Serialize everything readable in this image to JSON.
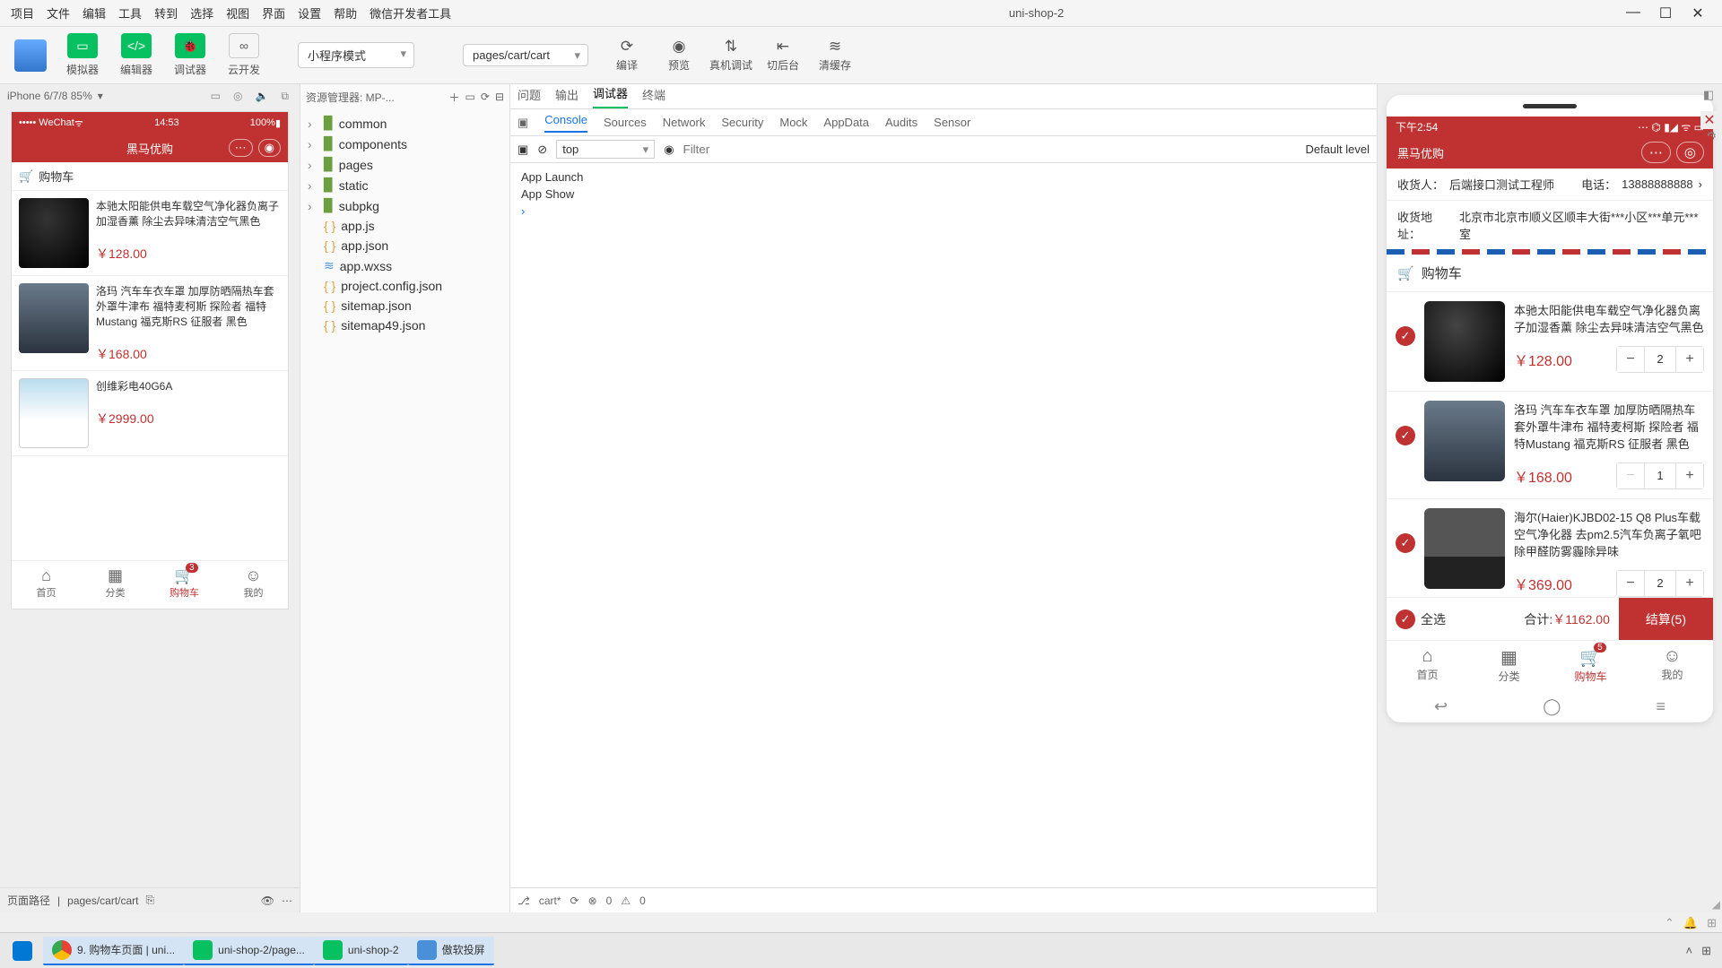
{
  "menu": [
    "项目",
    "文件",
    "编辑",
    "工具",
    "转到",
    "选择",
    "视图",
    "界面",
    "设置",
    "帮助",
    "微信开发者工具"
  ],
  "app_title": "uni-shop-2",
  "win_buttons": [
    "—",
    "☐",
    "✕"
  ],
  "toolbar": {
    "simulator": "模拟器",
    "editor": "编辑器",
    "debugger": "调试器",
    "cloud": "云开发",
    "mode": "小程序模式",
    "page": "pages/cart/cart",
    "compile": "编译",
    "preview": "预览",
    "realdebug": "真机调试",
    "bg": "切后台",
    "cache": "清缓存"
  },
  "sim": {
    "device": "iPhone 6/7/8 85%",
    "carrier": "••••• WeChat",
    "time": "14:53",
    "battery": "100%",
    "title": "黑马优购",
    "section": "购物车",
    "items": [
      {
        "title": "本驰太阳能供电车载空气净化器负离子加湿香薰 除尘去异味清洁空气黑色",
        "price": "￥128.00",
        "img": "black"
      },
      {
        "title": "洛玛 汽车车衣车罩 加厚防晒隔热车套外罩牛津布 福特麦柯斯 探险者 福特Mustang 福克斯RS 征服者 黑色",
        "price": "￥168.00",
        "img": "car"
      },
      {
        "title": "创维彩电40G6A",
        "price": "￥2999.00",
        "img": "tv"
      }
    ],
    "tabs": [
      "首页",
      "分类",
      "购物车",
      "我的"
    ],
    "badge": "3",
    "footer_label": "页面路径",
    "footer_path": "pages/cart/cart"
  },
  "tree": {
    "header": "资源管理器: MP-...",
    "folders": [
      "common",
      "components",
      "pages",
      "static",
      "subpkg"
    ],
    "files": [
      {
        "n": "app.js",
        "t": "js"
      },
      {
        "n": "app.json",
        "t": "json"
      },
      {
        "n": "app.wxss",
        "t": "css"
      },
      {
        "n": "project.config.json",
        "t": "json"
      },
      {
        "n": "sitemap.json",
        "t": "json"
      },
      {
        "n": "sitemap49.json",
        "t": "json"
      }
    ]
  },
  "dev": {
    "tabs1": [
      "问题",
      "输出",
      "调试器",
      "终端"
    ],
    "active1": "调试器",
    "tabs2": [
      "Console",
      "Sources",
      "Network",
      "Security",
      "Mock",
      "AppData",
      "Audits",
      "Sensor"
    ],
    "active2": "Console",
    "filter_scope": "top",
    "filter_placeholder": "Filter",
    "level": "Default level",
    "lines": [
      "App Launch",
      "App Show"
    ],
    "footer_file": "cart*",
    "footer_err": "0",
    "footer_warn": "0"
  },
  "prev": {
    "time": "下午2:54",
    "title": "黑马优购",
    "addr_name_label": "收货人：",
    "addr_name": "后端接口测试工程师",
    "phone_label": "电话：",
    "phone": "13888888888",
    "addr_label": "收货地址：",
    "addr": "北京市北京市顺义区顺丰大街***小区***单元***室",
    "section": "购物车",
    "items": [
      {
        "title": "本驰太阳能供电车载空气净化器负离子加湿香薰 除尘去异味清洁空气黑色",
        "price": "￥128.00",
        "qty": "2",
        "img": "black",
        "dis": false
      },
      {
        "title": "洛玛 汽车车衣车罩 加厚防晒隔热车套外罩牛津布 福特麦柯斯 探险者 福特Mustang 福克斯RS 征服者 黑色",
        "price": "￥168.00",
        "qty": "1",
        "img": "car",
        "dis": true
      },
      {
        "title": "海尔(Haier)KJBD02-15 Q8 Plus车载空气净化器 去pm2.5汽车负离子氧吧 除甲醛防雾霾除异味",
        "price": "￥369.00",
        "qty": "2",
        "img": "box",
        "dis": false
      }
    ],
    "selectall": "全选",
    "total_label": "合计:",
    "total": "￥1162.00",
    "checkout": "结算(5)",
    "tabs": [
      "首页",
      "分类",
      "购物车",
      "我的"
    ],
    "badge": "5"
  },
  "taskbar": {
    "items": [
      {
        "icon": "chrome",
        "label": "9. 购物车页面 | uni...",
        "active": true
      },
      {
        "icon": "hb",
        "label": "uni-shop-2/page...",
        "active": true
      },
      {
        "icon": "wx",
        "label": "uni-shop-2",
        "active": true
      },
      {
        "icon": "ar",
        "label": "傲软投屏",
        "active": true
      }
    ]
  }
}
